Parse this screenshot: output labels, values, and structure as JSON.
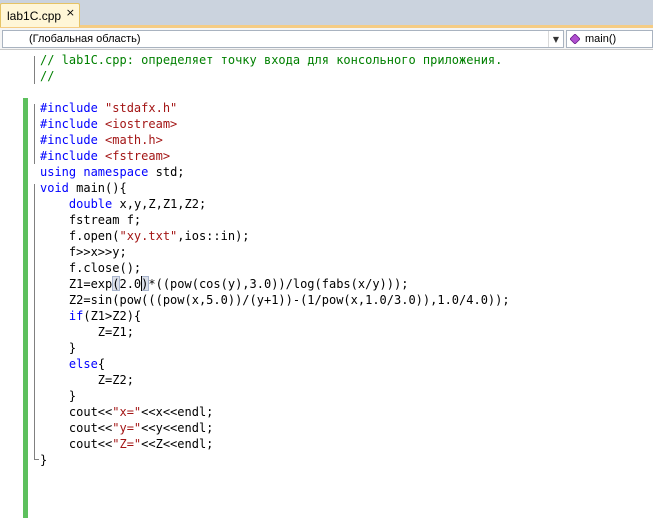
{
  "window": {
    "tab": {
      "label": "lab1C.cpp",
      "close_glyph": "×"
    }
  },
  "navbar": {
    "scope": "(Глобальная область)",
    "member": "main()"
  },
  "colors": {
    "keyword": "#0000ff",
    "string": "#a31515",
    "comment": "#008000",
    "change_bar": "#5dc05d"
  },
  "code": {
    "lines": [
      [
        {
          "t": "// lab1C.cpp: определяет точку входа для консольного приложения.",
          "c": "cm"
        }
      ],
      [
        {
          "t": "//",
          "c": "cm"
        }
      ],
      [],
      [
        {
          "t": "#include ",
          "c": "pp"
        },
        {
          "t": "\"stdafx.h\"",
          "c": "str"
        }
      ],
      [
        {
          "t": "#include ",
          "c": "pp"
        },
        {
          "t": "<iostream>",
          "c": "str"
        }
      ],
      [
        {
          "t": "#include ",
          "c": "pp"
        },
        {
          "t": "<math.h>",
          "c": "str"
        }
      ],
      [
        {
          "t": "#include ",
          "c": "pp"
        },
        {
          "t": "<fstream>",
          "c": "str"
        }
      ],
      [
        {
          "t": "using",
          "c": "kw"
        },
        {
          "t": " "
        },
        {
          "t": "namespace",
          "c": "kw"
        },
        {
          "t": " std;"
        }
      ],
      [
        {
          "t": "void",
          "c": "kw"
        },
        {
          "t": " main(){"
        }
      ],
      [
        {
          "t": "    "
        },
        {
          "t": "double",
          "c": "kw"
        },
        {
          "t": " x,y,Z,Z1,Z2;"
        }
      ],
      [
        {
          "t": "    fstream f;"
        }
      ],
      [
        {
          "t": "    f.open("
        },
        {
          "t": "\"xy.txt\"",
          "c": "str"
        },
        {
          "t": ",ios::in);"
        }
      ],
      [
        {
          "t": "    f>>x>>y;"
        }
      ],
      [
        {
          "t": "    f.close();"
        }
      ],
      [
        {
          "t": "    Z1=exp(2.0)*((pow(cos(y),3.0))/log(fabs(x/y)));"
        }
      ],
      [
        {
          "t": "    Z2=sin(pow(((pow(x,5.0))/(y+1))-(1/pow(x,1.0/3.0)),1.0/4.0));"
        }
      ],
      [
        {
          "t": "    "
        },
        {
          "t": "if",
          "c": "kw"
        },
        {
          "t": "(Z1>Z2){"
        }
      ],
      [
        {
          "t": "        Z=Z1;"
        }
      ],
      [
        {
          "t": "    }"
        }
      ],
      [
        {
          "t": "    "
        },
        {
          "t": "else",
          "c": "kw"
        },
        {
          "t": "{"
        }
      ],
      [
        {
          "t": "        Z=Z2;"
        }
      ],
      [
        {
          "t": "    }"
        }
      ],
      [
        {
          "t": "    cout<<"
        },
        {
          "t": "\"x=\"",
          "c": "str"
        },
        {
          "t": "<<x<<endl;"
        }
      ],
      [
        {
          "t": "    cout<<"
        },
        {
          "t": "\"y=\"",
          "c": "str"
        },
        {
          "t": "<<y<<endl;"
        }
      ],
      [
        {
          "t": "    cout<<"
        },
        {
          "t": "\"Z=\"",
          "c": "str"
        },
        {
          "t": "<<Z<<endl;"
        }
      ],
      [
        {
          "t": "}"
        }
      ]
    ]
  }
}
